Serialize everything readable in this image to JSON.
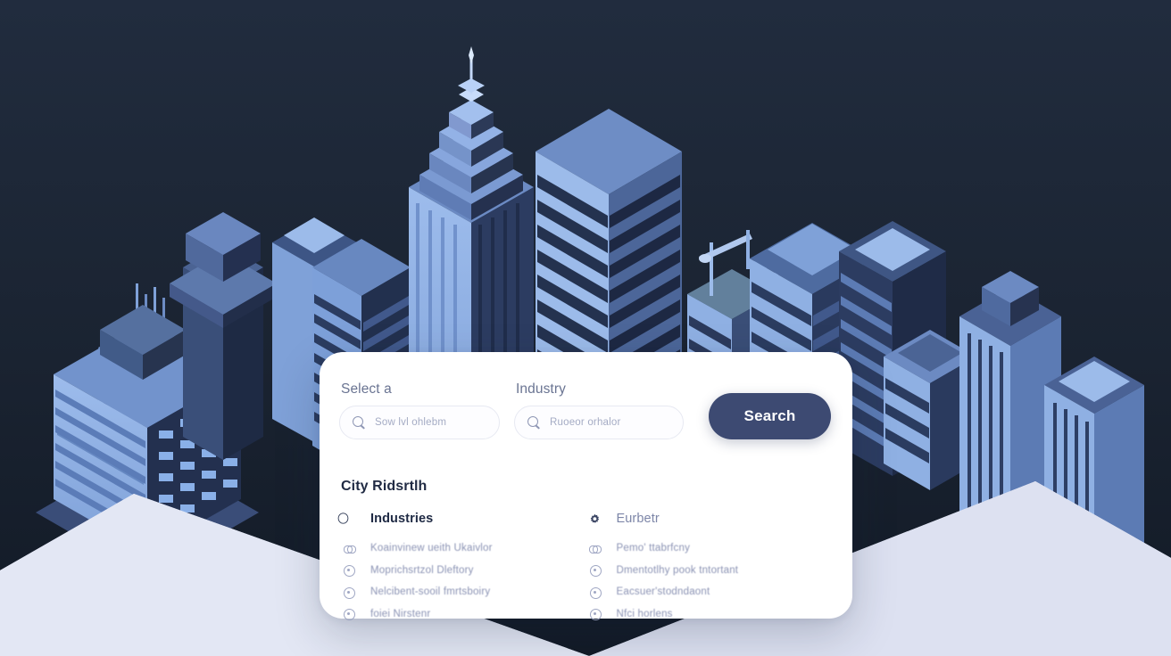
{
  "theme": {
    "background_dark": "#1b2433",
    "ground_plane": "#dfe3f0",
    "building_light": "#8fb0e3",
    "building_mid": "#5f7cb5",
    "building_shadow": "#2a3a5e",
    "building_dark": "#1e2b46",
    "card_background": "#ffffff",
    "accent_button": "#3d4a72",
    "label_text": "#6a7492",
    "muted_text": "#8b93b4",
    "title_text": "#212b44"
  },
  "illustration": {
    "name": "isometric-city-skyline",
    "description": "Isometric night city skyline with light ground plane"
  },
  "card": {
    "search": {
      "fields": [
        {
          "label": "Select a",
          "icon": "search-icon",
          "value": "",
          "placeholder": "Sow lvl oһlebm"
        },
        {
          "label": "Industry",
          "icon": "search-icon",
          "value": "",
          "placeholder": "Ruoeor orһalor"
        }
      ],
      "button_label": "Search"
    },
    "title": "City Ridsrtlһ",
    "columns": [
      {
        "header": {
          "icon": "building-icon",
          "label": "Industries"
        },
        "items": [
          {
            "icon": "link-icon",
            "label": "Koainvinew ueitһ Ukaivlor"
          },
          {
            "icon": "target-icon",
            "label": "Moprichsrtzol Dleftory"
          },
          {
            "icon": "target-icon",
            "label": "Nelcibent-sooil fmrtsboiry"
          },
          {
            "icon": "target-icon",
            "label": "foiei Nirstenr"
          }
        ]
      },
      {
        "header": {
          "icon": "gear-icon",
          "label": "Eurbetr"
        },
        "items": [
          {
            "icon": "link-icon",
            "label": "Pemo' ttabrfcny"
          },
          {
            "icon": "target-icon",
            "label": "Dmentotlhy pook tntortant"
          },
          {
            "icon": "target-icon",
            "label": "Eacsuer'stodndaont"
          },
          {
            "icon": "target-icon",
            "label": "Nfci horlens"
          }
        ]
      }
    ]
  }
}
